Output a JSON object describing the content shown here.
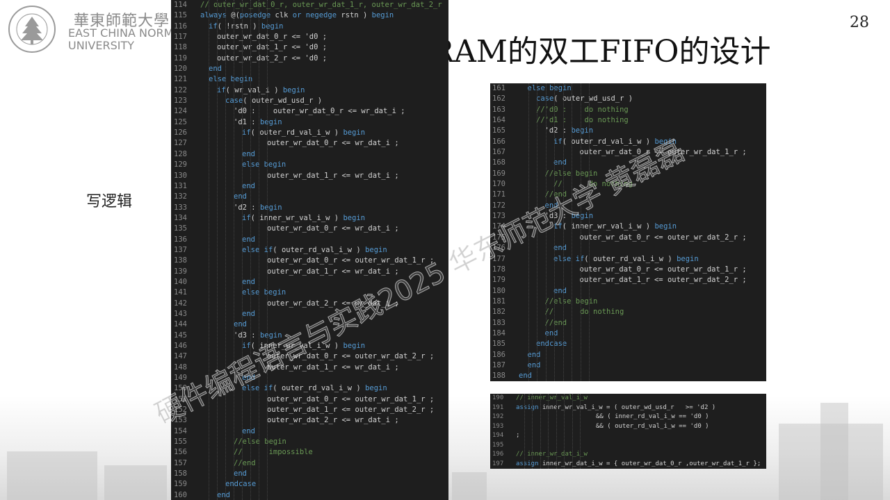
{
  "logo": {
    "chinese": "華東師範大學",
    "english_line1": "EAST CHINA NORMAL",
    "english_line2": "UNIVERSITY",
    "seal_text": "EAST CHINA NORMAL UNIVERSITY"
  },
  "page_number": "28",
  "title": "RAM的双工FIFO的设计",
  "side_label": "写逻辑",
  "watermark": "硬件编程语言与实践2025 华东师范大学 黄磊磊",
  "code_left": [
    {
      "n": "114",
      "i": 0,
      "t": "// outer_wr_dat_0_r, outer_wr_dat_1_r, outer_wr_dat_2_r",
      "c": "cm"
    },
    {
      "n": "115",
      "i": 0,
      "t": "always @(posedge clk or negedge rstn ) begin"
    },
    {
      "n": "116",
      "i": 1,
      "t": "if( !rstn ) begin"
    },
    {
      "n": "117",
      "i": 2,
      "t": "outer_wr_dat_0_r <= 'd0 ;"
    },
    {
      "n": "118",
      "i": 2,
      "t": "outer_wr_dat_1_r <= 'd0 ;"
    },
    {
      "n": "119",
      "i": 2,
      "t": "outer_wr_dat_2_r <= 'd0 ;"
    },
    {
      "n": "120",
      "i": 1,
      "t": "end",
      "c": "kw"
    },
    {
      "n": "121",
      "i": 1,
      "t": "else begin",
      "c": "kw"
    },
    {
      "n": "122",
      "i": 2,
      "t": "if( wr_val_i ) begin"
    },
    {
      "n": "123",
      "i": 3,
      "t": "case( outer_wd_usd_r )"
    },
    {
      "n": "124",
      "i": 4,
      "t": "'d0 :    outer_wr_dat_0_r <= wr_dat_i ;"
    },
    {
      "n": "125",
      "i": 4,
      "t": "'d1 : begin"
    },
    {
      "n": "126",
      "i": 5,
      "t": "if( outer_rd_val_i_w ) begin"
    },
    {
      "n": "127",
      "i": 8,
      "t": "outer_wr_dat_0_r <= wr_dat_i ;"
    },
    {
      "n": "128",
      "i": 5,
      "t": "end",
      "c": "kw"
    },
    {
      "n": "129",
      "i": 5,
      "t": "else begin",
      "c": "kw"
    },
    {
      "n": "130",
      "i": 8,
      "t": "outer_wr_dat_1_r <= wr_dat_i ;"
    },
    {
      "n": "131",
      "i": 5,
      "t": "end",
      "c": "kw"
    },
    {
      "n": "132",
      "i": 4,
      "t": "end",
      "c": "kw"
    },
    {
      "n": "133",
      "i": 4,
      "t": "'d2 : begin"
    },
    {
      "n": "134",
      "i": 5,
      "t": "if( inner_wr_val_i_w ) begin"
    },
    {
      "n": "135",
      "i": 8,
      "t": "outer_wr_dat_0_r <= wr_dat_i ;"
    },
    {
      "n": "136",
      "i": 5,
      "t": "end",
      "c": "kw"
    },
    {
      "n": "137",
      "i": 5,
      "t": "else if( outer_rd_val_i_w ) begin"
    },
    {
      "n": "138",
      "i": 8,
      "t": "outer_wr_dat_0_r <= outer_wr_dat_1_r ;"
    },
    {
      "n": "139",
      "i": 8,
      "t": "outer_wr_dat_1_r <= wr_dat_i ;"
    },
    {
      "n": "140",
      "i": 5,
      "t": "end",
      "c": "kw"
    },
    {
      "n": "141",
      "i": 5,
      "t": "else begin",
      "c": "kw"
    },
    {
      "n": "142",
      "i": 8,
      "t": "outer_wr_dat_2_r <= wr_dat_i ;"
    },
    {
      "n": "143",
      "i": 5,
      "t": "end",
      "c": "kw"
    },
    {
      "n": "144",
      "i": 4,
      "t": "end",
      "c": "kw"
    },
    {
      "n": "145",
      "i": 4,
      "t": "'d3 : begin"
    },
    {
      "n": "146",
      "i": 5,
      "t": "if( inner_wr_val_i_w ) begin"
    },
    {
      "n": "147",
      "i": 8,
      "t": "outer_wr_dat_0_r <= outer_wr_dat_2_r ;"
    },
    {
      "n": "148",
      "i": 8,
      "t": "outer_wr_dat_1_r <= wr_dat_i ;"
    },
    {
      "n": "149",
      "i": 5,
      "t": "end",
      "c": "kw"
    },
    {
      "n": "150",
      "i": 5,
      "t": "else if( outer_rd_val_i_w ) begin"
    },
    {
      "n": "151",
      "i": 8,
      "t": "outer_wr_dat_0_r <= outer_wr_dat_1_r ;"
    },
    {
      "n": "152",
      "i": 8,
      "t": "outer_wr_dat_1_r <= outer_wr_dat_2_r ;"
    },
    {
      "n": "153",
      "i": 8,
      "t": "outer_wr_dat_2_r <= wr_dat_i ;"
    },
    {
      "n": "154",
      "i": 5,
      "t": "end",
      "c": "kw"
    },
    {
      "n": "155",
      "i": 4,
      "t": "//else begin",
      "c": "cm"
    },
    {
      "n": "156",
      "i": 4,
      "t": "//      impossible",
      "c": "cm"
    },
    {
      "n": "157",
      "i": 4,
      "t": "//end",
      "c": "cm"
    },
    {
      "n": "158",
      "i": 4,
      "t": "end",
      "c": "kw"
    },
    {
      "n": "159",
      "i": 3,
      "t": "endcase",
      "c": "kw"
    },
    {
      "n": "160",
      "i": 2,
      "t": "end",
      "c": "kw"
    }
  ],
  "code_right_top": [
    {
      "n": "161",
      "i": 1,
      "t": "else begin",
      "c": "kw"
    },
    {
      "n": "162",
      "i": 2,
      "t": "case( outer_wd_usd_r )"
    },
    {
      "n": "163",
      "i": 2,
      "t": "//'d0 :    do nothing",
      "c": "cm"
    },
    {
      "n": "164",
      "i": 2,
      "t": "//'d1 :    do nothing",
      "c": "cm"
    },
    {
      "n": "165",
      "i": 3,
      "t": "'d2 : begin"
    },
    {
      "n": "166",
      "i": 4,
      "t": "if( outer_rd_val_i_w ) begin"
    },
    {
      "n": "167",
      "i": 7,
      "t": "outer_wr_dat_0_r <= outer_wr_dat_1_r ;"
    },
    {
      "n": "168",
      "i": 4,
      "t": "end",
      "c": "kw"
    },
    {
      "n": "169",
      "i": 3,
      "t": "//else begin",
      "c": "cm"
    },
    {
      "n": "170",
      "i": 4,
      "t": "//      do nothing",
      "c": "cm"
    },
    {
      "n": "171",
      "i": 3,
      "t": "//end",
      "c": "cm"
    },
    {
      "n": "172",
      "i": 3,
      "t": "end",
      "c": "kw"
    },
    {
      "n": "173",
      "i": 3,
      "t": "'d3 : begin"
    },
    {
      "n": "174",
      "i": 4,
      "t": "if( inner_wr_val_i_w ) begin"
    },
    {
      "n": "175",
      "i": 7,
      "t": "outer_wr_dat_0_r <= outer_wr_dat_2_r ;"
    },
    {
      "n": "176",
      "i": 4,
      "t": "end",
      "c": "kw"
    },
    {
      "n": "177",
      "i": 4,
      "t": "else if( outer_rd_val_i_w ) begin"
    },
    {
      "n": "178",
      "i": 7,
      "t": "outer_wr_dat_0_r <= outer_wr_dat_1_r ;"
    },
    {
      "n": "179",
      "i": 7,
      "t": "outer_wr_dat_1_r <= outer_wr_dat_2_r ;"
    },
    {
      "n": "180",
      "i": 4,
      "t": "end",
      "c": "kw"
    },
    {
      "n": "181",
      "i": 3,
      "t": "//else begin",
      "c": "cm"
    },
    {
      "n": "182",
      "i": 3,
      "t": "//      do nothing",
      "c": "cm"
    },
    {
      "n": "183",
      "i": 3,
      "t": "//end",
      "c": "cm"
    },
    {
      "n": "184",
      "i": 3,
      "t": "end",
      "c": "kw"
    },
    {
      "n": "185",
      "i": 2,
      "t": "endcase",
      "c": "kw"
    },
    {
      "n": "186",
      "i": 1,
      "t": "end",
      "c": "kw"
    },
    {
      "n": "187",
      "i": 1,
      "t": "end",
      "c": "kw"
    },
    {
      "n": "188",
      "i": 0,
      "t": "end",
      "c": "kw"
    }
  ],
  "code_right_bottom": [
    {
      "n": "190",
      "i": 0,
      "t": "// inner_wr_val_i_w",
      "c": "cm"
    },
    {
      "n": "191",
      "i": 0,
      "t": "assign inner_wr_val_i_w = ( outer_wd_usd_r   >= 'd2 )"
    },
    {
      "n": "192",
      "i": 10,
      "t": "&& ( inner_rd_val_i_w == 'd0 )"
    },
    {
      "n": "193",
      "i": 10,
      "t": "&& ( outer_rd_val_i_w == 'd0 )"
    },
    {
      "n": "194",
      "i": 0,
      "t": ";"
    },
    {
      "n": "195",
      "i": 0,
      "t": ""
    },
    {
      "n": "196",
      "i": 0,
      "t": "// inner_wr_dat_i_w",
      "c": "cm"
    },
    {
      "n": "197",
      "i": 0,
      "t": "assign inner_wr_dat_i_w = { outer_wr_dat_0_r ,outer_wr_dat_1_r };"
    }
  ]
}
